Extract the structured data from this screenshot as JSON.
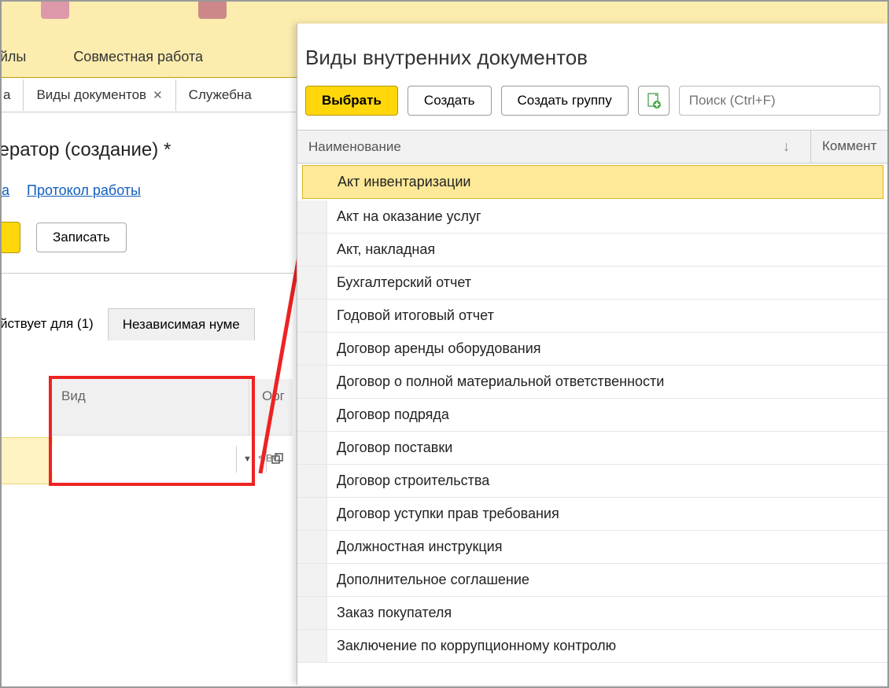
{
  "bg": {
    "menu": [
      "ы и файлы",
      "Совместная работа"
    ],
    "tabs": [
      {
        "label": "а"
      },
      {
        "label": "Виды документов",
        "closable": true
      },
      {
        "label": "Служебна"
      }
    ],
    "title": "мератор (создание) *",
    "links": [
      "ера",
      "Протокол работы"
    ],
    "write_label": "Записать",
    "subtabs": [
      {
        "label": "йствует для (1)",
        "active": false
      },
      {
        "label": "Независимая нуме",
        "active": true
      }
    ],
    "grid": {
      "col_vid": "Вид",
      "col_org": "Орг",
      "all_placeholder": "<вс"
    }
  },
  "dialog": {
    "title": "Виды внутренних документов",
    "btn_select": "Выбрать",
    "btn_create": "Создать",
    "btn_create_group": "Создать группу",
    "search_placeholder": "Поиск (Ctrl+F)",
    "col_name": "Наименование",
    "col_comment": "Коммент",
    "rows": [
      {
        "label": "Акт инвентаризации",
        "selected": true
      },
      {
        "label": "Акт на оказание услуг"
      },
      {
        "label": "Акт, накладная"
      },
      {
        "label": "Бухгалтерский отчет"
      },
      {
        "label": "Годовой итоговый отчет"
      },
      {
        "label": "Договор аренды оборудования"
      },
      {
        "label": "Договор о полной материальной ответственности"
      },
      {
        "label": "Договор подряда"
      },
      {
        "label": "Договор поставки"
      },
      {
        "label": "Договор строительства"
      },
      {
        "label": "Договор уступки прав требования"
      },
      {
        "label": "Должностная инструкция"
      },
      {
        "label": "Дополнительное соглашение"
      },
      {
        "label": "Заказ покупателя"
      },
      {
        "label": "Заключение по коррупционному контролю"
      }
    ]
  }
}
